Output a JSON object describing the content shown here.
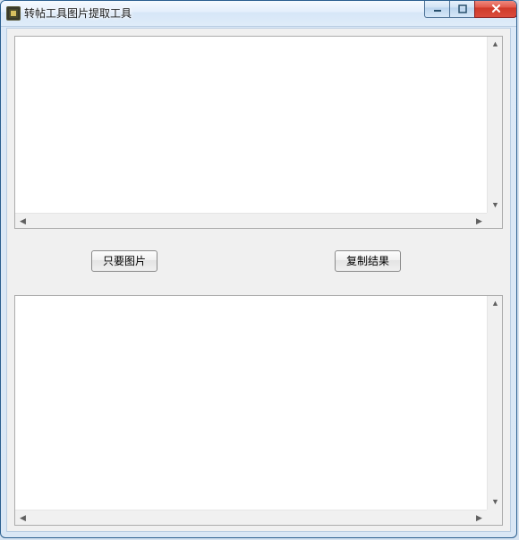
{
  "window": {
    "title": "转帖工具图片提取工具"
  },
  "controls": {
    "minimize_tip": "Minimize",
    "maximize_tip": "Maximize",
    "close_tip": "Close"
  },
  "buttons": {
    "extract_images": "只要图片",
    "copy_result": "复制结果"
  },
  "input_area": {
    "value": "",
    "placeholder": ""
  },
  "output_area": {
    "value": "",
    "placeholder": ""
  }
}
